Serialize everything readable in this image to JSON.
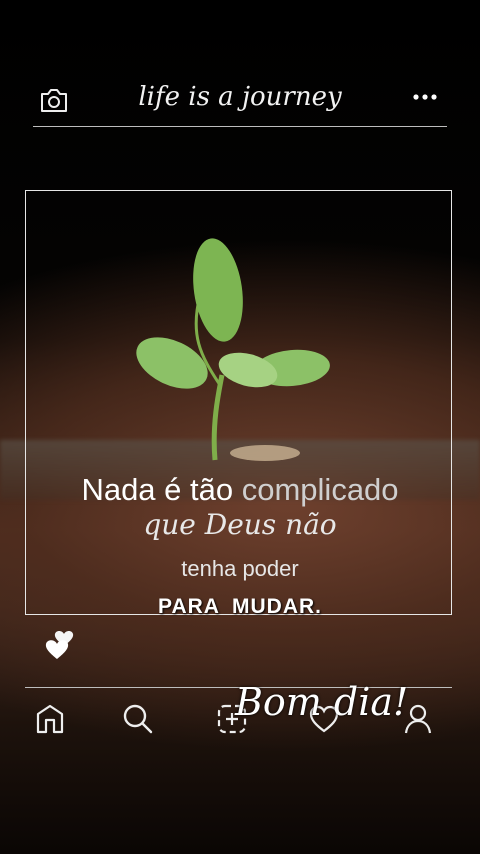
{
  "header": {
    "title": "life is a journey",
    "camera_icon": "camera-icon",
    "more_icon": "more-dots-icon"
  },
  "post": {
    "line1_a": "Nada é tão",
    "line1_b": "complicado",
    "line2": "que Deus não",
    "line3": "tenha poder",
    "line4": "PARA MUDAR."
  },
  "reaction": {
    "icon": "hearts-icon"
  },
  "nav": {
    "items": [
      "home-icon",
      "search-icon",
      "add-icon",
      "heart-icon",
      "profile-icon"
    ]
  },
  "overlay": {
    "greeting": "Bom dia!"
  }
}
